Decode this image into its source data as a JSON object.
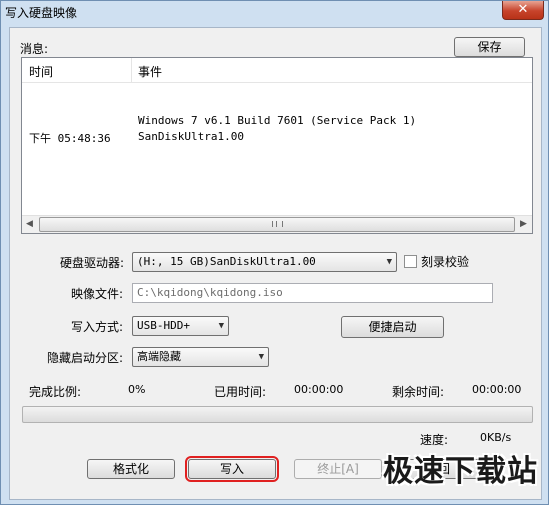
{
  "window": {
    "title": "写入硬盘映像",
    "close_glyph": "✕"
  },
  "messages": {
    "label": "消息:",
    "save_button": "保存",
    "columns": [
      "时间",
      "事件"
    ],
    "rows": [
      {
        "time": "",
        "event": "Windows 7 v6.1 Build 7601 (Service Pack 1)"
      },
      {
        "time": "下午 05:48:36",
        "event": "SanDiskUltra1.00"
      }
    ],
    "scroll_left": "◀",
    "scroll_right": "▶"
  },
  "form": {
    "drive_label": "硬盘驱动器:",
    "drive_value": "(H:, 15 GB)SanDiskUltra1.00",
    "verify_label": "刻录校验",
    "verify_checked": false,
    "image_label": "映像文件:",
    "image_value": "C:\\kqidong\\kqidong.iso",
    "write_method_label": "写入方式:",
    "write_method_value": "USB-HDD+",
    "quick_boot_button": "便捷启动",
    "hidden_partition_label": "隐藏启动分区:",
    "hidden_partition_value": "高端隐藏",
    "caret": "▼"
  },
  "status": {
    "complete_label": "完成比例:",
    "complete_value": "0%",
    "elapsed_label": "已用时间:",
    "elapsed_value": "00:00:00",
    "remaining_label": "剩余时间:",
    "remaining_value": "00:00:00",
    "progress_fraction": 0,
    "speed_label": "速度:",
    "speed_value": "0KB/s"
  },
  "buttons": {
    "format": "格式化",
    "write": "写入",
    "abort": "终止[A]",
    "back": "返回"
  },
  "watermark": "极速下载站",
  "colors": {
    "progress_fill": "#4ec34e",
    "highlight": "#e02020"
  }
}
